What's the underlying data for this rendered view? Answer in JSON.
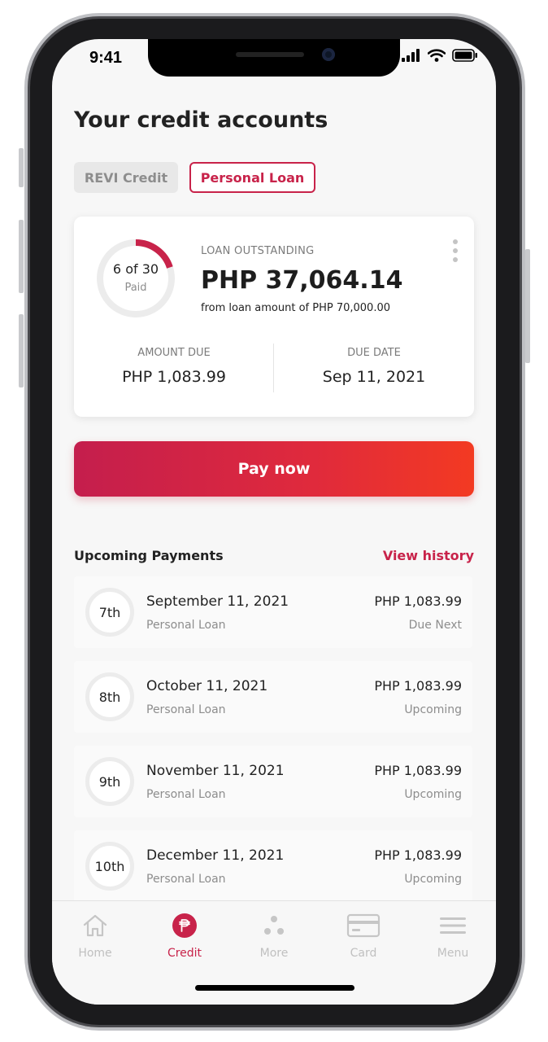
{
  "status_bar": {
    "time": "9:41"
  },
  "page": {
    "title": "Your credit accounts"
  },
  "tabs": [
    {
      "label": "REVI Credit",
      "active": false
    },
    {
      "label": "Personal Loan",
      "active": true
    }
  ],
  "loan_card": {
    "paid_count": "6 of 30",
    "paid_label": "Paid",
    "paid_fraction": 0.2,
    "outstanding_label": "LOAN OUTSTANDING",
    "outstanding_amount": "PHP 37,064.14",
    "from_text": "from loan amount of PHP 70,000.00",
    "amount_due_label": "AMOUNT DUE",
    "amount_due_value": "PHP 1,083.99",
    "due_date_label": "DUE DATE",
    "due_date_value": "Sep 11, 2021"
  },
  "pay_button": {
    "label": "Pay now"
  },
  "upcoming": {
    "title": "Upcoming Payments",
    "view_history": "View history",
    "items": [
      {
        "ordinal": "7th",
        "date": "September 11, 2021",
        "type": "Personal Loan",
        "amount": "PHP 1,083.99",
        "status": "Due Next"
      },
      {
        "ordinal": "8th",
        "date": "October 11, 2021",
        "type": "Personal Loan",
        "amount": "PHP 1,083.99",
        "status": "Upcoming"
      },
      {
        "ordinal": "9th",
        "date": "November 11, 2021",
        "type": "Personal Loan",
        "amount": "PHP 1,083.99",
        "status": "Upcoming"
      },
      {
        "ordinal": "10th",
        "date": "December 11, 2021",
        "type": "Personal Loan",
        "amount": "PHP 1,083.99",
        "status": "Upcoming"
      }
    ]
  },
  "nav": [
    {
      "label": "Home",
      "icon": "home-icon",
      "active": false
    },
    {
      "label": "Credit",
      "icon": "peso-icon",
      "active": true
    },
    {
      "label": "More",
      "icon": "dots-icon",
      "active": false
    },
    {
      "label": "Card",
      "icon": "card-icon",
      "active": false
    },
    {
      "label": "Menu",
      "icon": "menu-icon",
      "active": false
    }
  ],
  "colors": {
    "accent": "#c8234a",
    "gradient_start": "#c41e4d",
    "gradient_end": "#f33a22",
    "muted": "#8d8d8d"
  }
}
